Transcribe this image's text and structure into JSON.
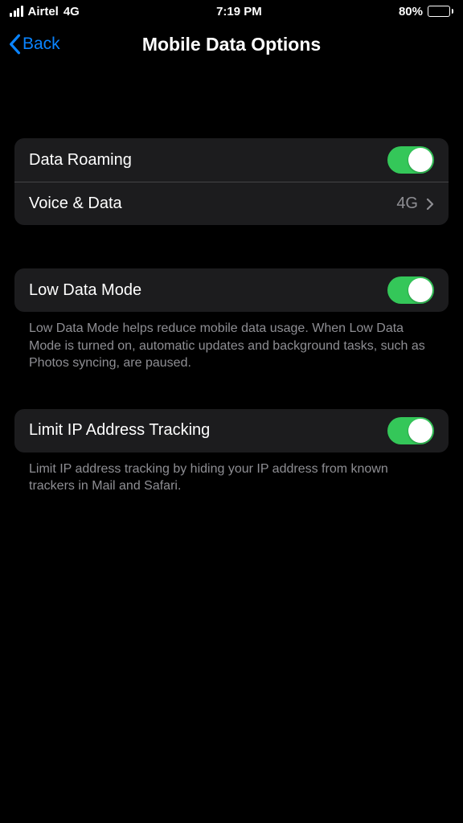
{
  "status": {
    "carrier": "Airtel",
    "network": "4G",
    "time": "7:19 PM",
    "battery_pct": "80%"
  },
  "nav": {
    "back_label": "Back",
    "title": "Mobile Data Options"
  },
  "rows": {
    "data_roaming": {
      "label": "Data Roaming",
      "on": true
    },
    "voice_data": {
      "label": "Voice & Data",
      "value": "4G"
    },
    "low_data_mode": {
      "label": "Low Data Mode",
      "on": true
    },
    "limit_ip": {
      "label": "Limit IP Address Tracking",
      "on": true
    }
  },
  "footers": {
    "low_data_mode": "Low Data Mode helps reduce mobile data usage. When Low Data Mode is turned on, automatic updates and background tasks, such as Photos syncing, are paused.",
    "limit_ip": "Limit IP address tracking by hiding your IP address from known trackers in Mail and Safari."
  }
}
